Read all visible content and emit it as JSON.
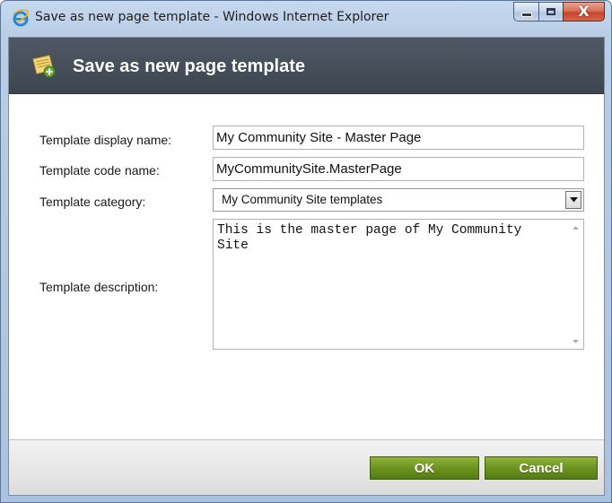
{
  "window": {
    "title": "Save as new page template - Windows Internet Explorer",
    "app_icon": "internet-explorer-icon",
    "controls": {
      "minimize": "minimize-icon",
      "maximize": "maximize-icon",
      "close": "close-icon",
      "close_glyph": "X"
    }
  },
  "dialog": {
    "icon": "page-template-add-icon",
    "title": "Save as new page template"
  },
  "form": {
    "display_name": {
      "label": "Template display name:",
      "value": "My Community Site - Master Page"
    },
    "code_name": {
      "label": "Template code name:",
      "value": "MyCommunitySite.MasterPage"
    },
    "category": {
      "label": "Template category:",
      "selected": "My Community Site templates",
      "arrow_icon": "dropdown-arrow-icon"
    },
    "description": {
      "label": "Template description:",
      "value": "This is the master page of My Community Site"
    }
  },
  "footer": {
    "ok_label": "OK",
    "cancel_label": "Cancel"
  },
  "colors": {
    "header_bg": "#464e59",
    "button_green": "#6c9320",
    "close_red": "#c8452b"
  }
}
